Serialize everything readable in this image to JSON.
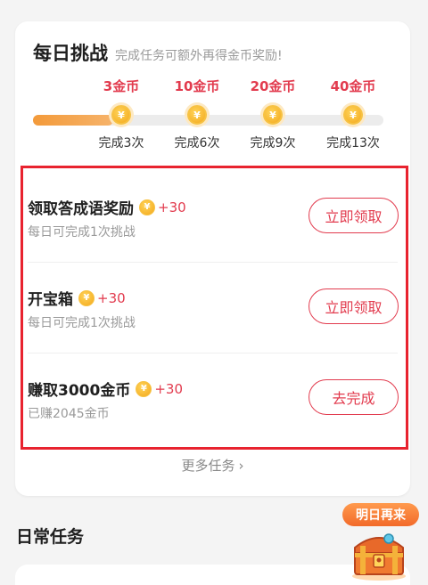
{
  "challenge": {
    "title": "每日挑战",
    "subtitle": "完成任务可额外再得金币奖励!",
    "progress": 0.23,
    "milestones": [
      {
        "reward": "3金币",
        "label": "完成3次"
      },
      {
        "reward": "10金币",
        "label": "完成6次"
      },
      {
        "reward": "20金币",
        "label": "完成9次"
      },
      {
        "reward": "40金币",
        "label": "完成13次"
      }
    ],
    "coin_symbol": "¥"
  },
  "tasks": [
    {
      "title": "领取答成语奖励",
      "reward": "+30",
      "desc": "每日可完成1次挑战",
      "button": "立即领取"
    },
    {
      "title": "开宝箱",
      "reward": "+30",
      "desc": "每日可完成1次挑战",
      "button": "立即领取"
    },
    {
      "title": "赚取3000金币",
      "reward": "+30",
      "desc": "已赚2045金币",
      "button": "去完成"
    }
  ],
  "more_tasks": "更多任务",
  "daily_section_title": "日常任务",
  "chest_badge": "明日再来",
  "colors": {
    "accent_red": "#e23b4e",
    "highlight_border": "#e8232f",
    "progress_orange": "#f39a3a",
    "coin_gold": "#f3a81c"
  }
}
